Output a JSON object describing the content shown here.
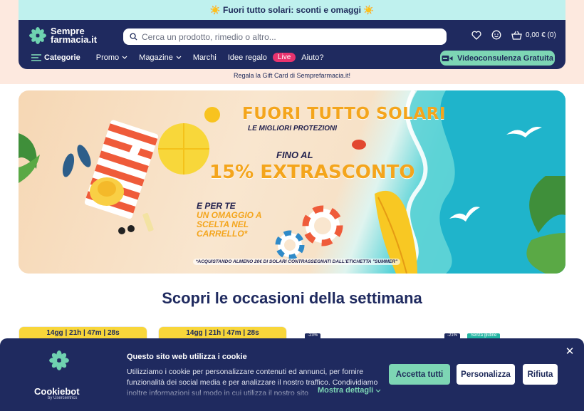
{
  "promo_strip": {
    "text": "☀️ Fuori tutto solari: sconti e omaggi ☀️"
  },
  "header": {
    "logo_line1": "Sempre",
    "logo_line2": "farmacia.it",
    "search_placeholder": "Cerca un prodotto, rimedio o altro...",
    "cart_text": "0,00 € (0)",
    "nav": {
      "categories": "Categorie",
      "promo": "Promo",
      "magazine": "Magazine",
      "brands": "Marchi",
      "gift_ideas": "Idee regalo",
      "live": "Live",
      "help": "Aiuto?"
    },
    "video_button": "Videoconsulenza Gratuita"
  },
  "gift_line": "Regala la Gift Card di Semprefarmacia.it!",
  "hero": {
    "title": "FUORI TUTTO SOLARI",
    "subtitle": "LE MIGLIORI PROTEZIONI",
    "fino": "FINO AL",
    "discount": "15% EXTRASCONTO",
    "gift_line1": "E PER TE",
    "gift_line2": "UN OMAGGIO A SCELTA NEL CARRELLO*",
    "note": "*ACQUISTANDO ALMENO 20€ DI SOLARI CONTRASSEGNATI DALL'ETICHETTA \"SUMMER\""
  },
  "section_title": "Scopri le occasioni della settimana",
  "deal_cards": {
    "timer1": "14gg | 21h | 47m | 28s",
    "timer2": "14gg | 21h | 47m | 28s",
    "tag3": "-23%",
    "tag4": "-21%",
    "tag4_green": "Senza glutine"
  },
  "cookie": {
    "brand": "Cookiebot",
    "brand_by": "by Usercentrics",
    "title": "Questo sito web utilizza i cookie",
    "text": "Utilizziamo i cookie per personalizzare contenuti ed annunci, per fornire funzionalità dei social media e per analizzare il nostro traffico. Condividiamo inoltre informazioni sul modo in cui utilizza il nostro sito",
    "details": "Mostra dettagli",
    "accept": "Accetta tutti",
    "customize": "Personalizza",
    "reject": "Rifiuta",
    "close": "✕"
  },
  "colors": {
    "navy": "#1f2a5f",
    "mint": "#7dd6b4",
    "promo_bg": "#bff1ee",
    "peach": "#fde9df",
    "live_pink": "#e8336e",
    "timer_yellow": "#f8d63a"
  }
}
